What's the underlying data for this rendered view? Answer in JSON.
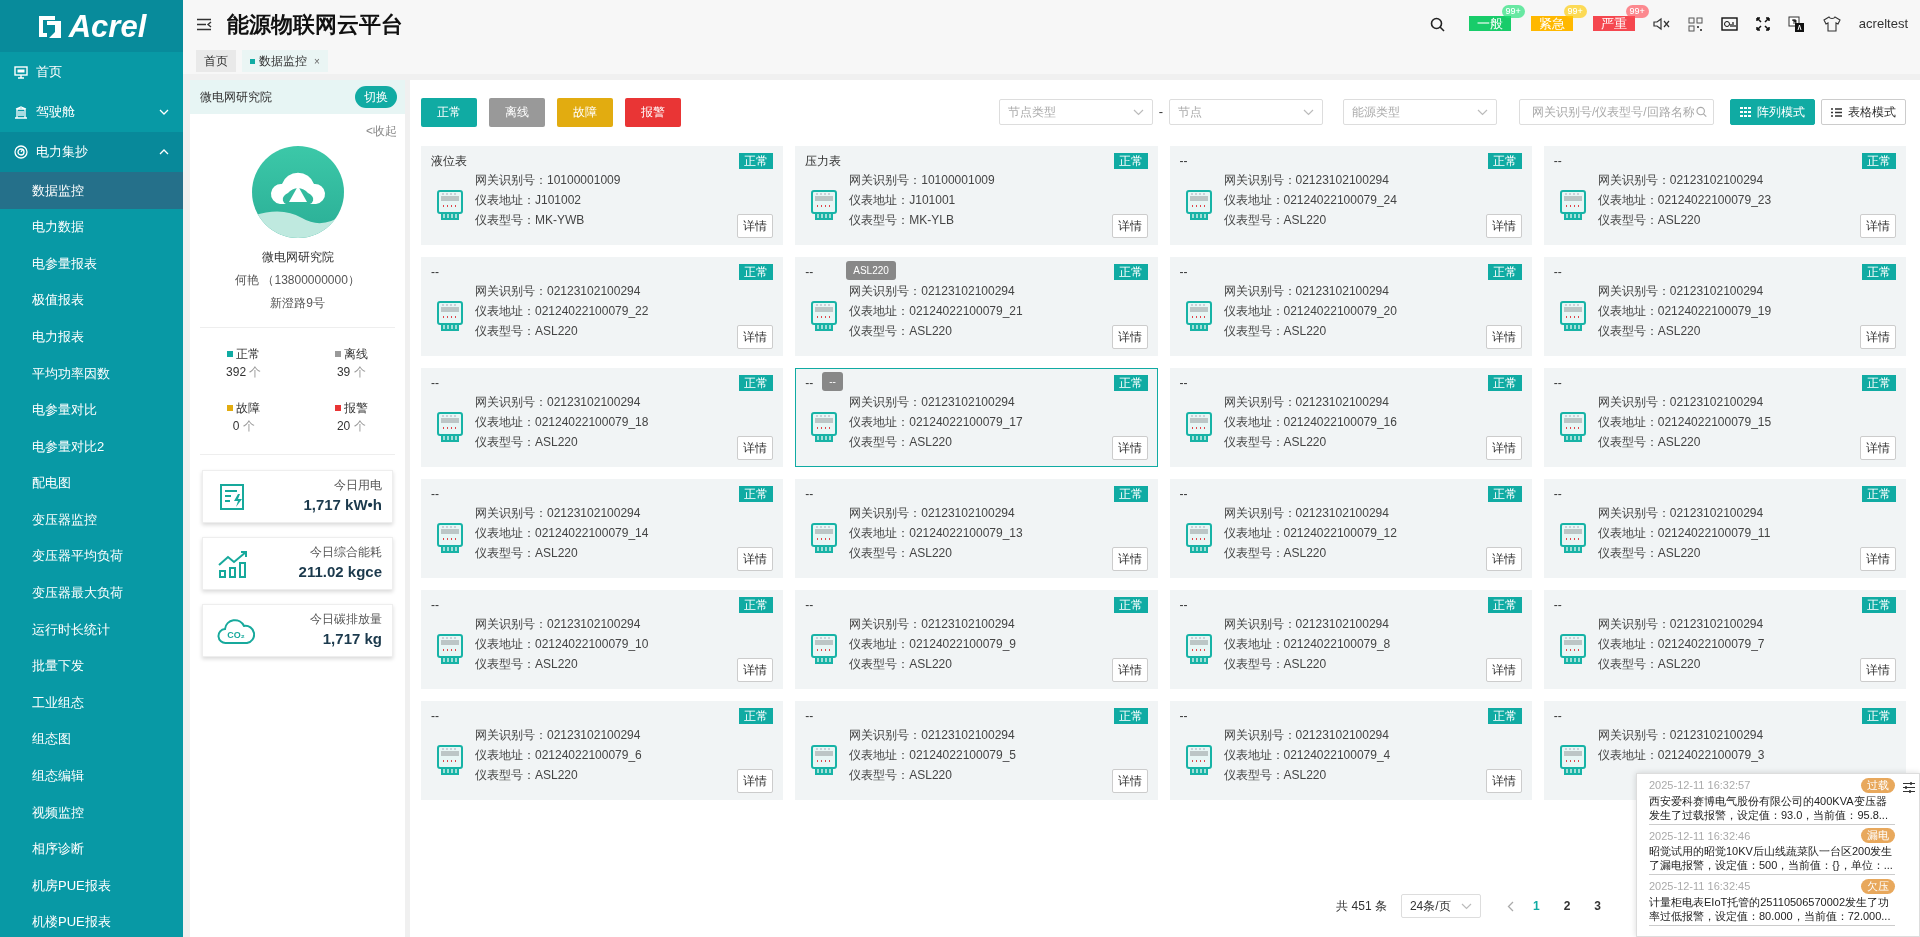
{
  "sidebar": {
    "logo": "Acrel",
    "items": [
      {
        "label": "首页",
        "selected": false
      },
      {
        "label": "驾驶舱",
        "selected": false,
        "expanded": false
      },
      {
        "label": "电力集抄",
        "selected": false,
        "expanded": true,
        "children": [
          {
            "label": "数据监控",
            "selected": true
          },
          {
            "label": "电力数据",
            "selected": false
          },
          {
            "label": "电参量报表",
            "selected": false
          },
          {
            "label": "极值报表",
            "selected": false
          },
          {
            "label": "电力报表",
            "selected": false
          },
          {
            "label": "平均功率因数",
            "selected": false
          },
          {
            "label": "电参量对比",
            "selected": false
          },
          {
            "label": "电参量对比2",
            "selected": false
          },
          {
            "label": "配电图",
            "selected": false
          },
          {
            "label": "变压器监控",
            "selected": false
          },
          {
            "label": "变压器平均负荷",
            "selected": false
          },
          {
            "label": "变压器最大负荷",
            "selected": false
          },
          {
            "label": "运行时长统计",
            "selected": false
          },
          {
            "label": "批量下发",
            "selected": false
          },
          {
            "label": "工业组态",
            "selected": false
          },
          {
            "label": "组态图",
            "selected": false
          },
          {
            "label": "组态编辑",
            "selected": false
          },
          {
            "label": "视频监控",
            "selected": false
          },
          {
            "label": "相序诊断",
            "selected": false
          },
          {
            "label": "机房PUE报表",
            "selected": false
          },
          {
            "label": "机楼PUE报表",
            "selected": false
          }
        ]
      }
    ]
  },
  "header": {
    "title": "能源物联网云平台",
    "alerts": [
      {
        "label": "一般",
        "count": "99+",
        "color": "#18cc6a"
      },
      {
        "label": "紧急",
        "count": "99+",
        "color": "#ffb800"
      },
      {
        "label": "严重",
        "count": "99+",
        "color": "#f5474f"
      }
    ],
    "user": "acreltest"
  },
  "tabs": [
    {
      "label": "首页",
      "selected": false
    },
    {
      "label": "数据监控",
      "selected": true,
      "close": "×"
    }
  ],
  "station": {
    "name": "微电网研究院",
    "switch_label": "切换",
    "collapse_label": "<收起",
    "title": "微电网研究院",
    "contact": "何艳 （13800000000）",
    "address": "新澄路9号",
    "status_counts": [
      {
        "label": "正常",
        "count": "392",
        "unit": "个",
        "color": "#10aba3"
      },
      {
        "label": "离线",
        "count": "39",
        "unit": "个",
        "color": "#999999"
      },
      {
        "label": "故障",
        "count": "0",
        "unit": "个",
        "color": "#e2ac10"
      },
      {
        "label": "报警",
        "count": "20",
        "unit": "个",
        "color": "#e93535"
      }
    ],
    "stats": [
      {
        "label": "今日用电",
        "value": "1,717 kW•h"
      },
      {
        "label": "今日综合能耗",
        "value": "211.02 kgce"
      },
      {
        "icon_text": "CO₂",
        "label": "今日碳排放量",
        "value": "1,717 kg"
      }
    ]
  },
  "status_filters": [
    {
      "label": "正常",
      "color": "#10aba3"
    },
    {
      "label": "离线",
      "color": "#999999"
    },
    {
      "label": "故障",
      "color": "#e2ac10"
    },
    {
      "label": "报警",
      "color": "#e93535"
    }
  ],
  "filters": {
    "selects": [
      {
        "placeholder": "节点类型"
      },
      {
        "placeholder": "节点"
      },
      {
        "placeholder": "能源类型"
      }
    ],
    "separator": "-",
    "search_placeholder": "网关识别号/仪表型号/回路名称",
    "view_modes": [
      {
        "label": "阵列模式",
        "selected": true
      },
      {
        "label": "表格模式",
        "selected": false
      }
    ]
  },
  "cards": [
    {
      "title": "液位表",
      "status": "正常",
      "gateway": "网关识别号：10100001009",
      "address": "仪表地址：J101002",
      "model": "仪表型号：MK-YWB",
      "detail": "详情",
      "selected": false
    },
    {
      "title": "压力表",
      "status": "正常",
      "gateway": "网关识别号：10100001009",
      "address": "仪表地址：J101001",
      "model": "仪表型号：MK-YLB",
      "detail": "详情",
      "selected": false
    },
    {
      "title": "--",
      "status": "正常",
      "gateway": "网关识别号：02123102100294",
      "address": "仪表地址：02124022100079_24",
      "model": "仪表型号：ASL220",
      "detail": "详情",
      "selected": false
    },
    {
      "title": "--",
      "status": "正常",
      "gateway": "网关识别号：02123102100294",
      "address": "仪表地址：02124022100079_23",
      "model": "仪表型号：ASL220",
      "detail": "详情",
      "selected": false
    },
    {
      "title": "--",
      "status": "正常",
      "gateway": "网关识别号：02123102100294",
      "address": "仪表地址：02124022100079_22",
      "model": "仪表型号：ASL220",
      "detail": "详情",
      "selected": false
    },
    {
      "title": "--",
      "status": "正常",
      "gateway": "网关识别号：02123102100294",
      "address": "仪表地址：02124022100079_21",
      "model": "仪表型号：ASL220",
      "detail": "详情",
      "selected": false,
      "tooltip": "ASL220"
    },
    {
      "title": "--",
      "status": "正常",
      "gateway": "网关识别号：02123102100294",
      "address": "仪表地址：02124022100079_20",
      "model": "仪表型号：ASL220",
      "detail": "详情",
      "selected": false
    },
    {
      "title": "--",
      "status": "正常",
      "gateway": "网关识别号：02123102100294",
      "address": "仪表地址：02124022100079_19",
      "model": "仪表型号：ASL220",
      "detail": "详情",
      "selected": false
    },
    {
      "title": "--",
      "status": "正常",
      "gateway": "网关识别号：02123102100294",
      "address": "仪表地址：02124022100079_18",
      "model": "仪表型号：ASL220",
      "detail": "详情",
      "selected": false
    },
    {
      "title": "--",
      "status": "正常",
      "gateway": "网关识别号：02123102100294",
      "address": "仪表地址：02124022100079_17",
      "model": "仪表型号：ASL220",
      "detail": "详情",
      "selected": true,
      "title_tooltip": "--"
    },
    {
      "title": "--",
      "status": "正常",
      "gateway": "网关识别号：02123102100294",
      "address": "仪表地址：02124022100079_16",
      "model": "仪表型号：ASL220",
      "detail": "详情",
      "selected": false
    },
    {
      "title": "--",
      "status": "正常",
      "gateway": "网关识别号：02123102100294",
      "address": "仪表地址：02124022100079_15",
      "model": "仪表型号：ASL220",
      "detail": "详情",
      "selected": false
    },
    {
      "title": "--",
      "status": "正常",
      "gateway": "网关识别号：02123102100294",
      "address": "仪表地址：02124022100079_14",
      "model": "仪表型号：ASL220",
      "detail": "详情",
      "selected": false
    },
    {
      "title": "--",
      "status": "正常",
      "gateway": "网关识别号：02123102100294",
      "address": "仪表地址：02124022100079_13",
      "model": "仪表型号：ASL220",
      "detail": "详情",
      "selected": false
    },
    {
      "title": "--",
      "status": "正常",
      "gateway": "网关识别号：02123102100294",
      "address": "仪表地址：02124022100079_12",
      "model": "仪表型号：ASL220",
      "detail": "详情",
      "selected": false
    },
    {
      "title": "--",
      "status": "正常",
      "gateway": "网关识别号：02123102100294",
      "address": "仪表地址：02124022100079_11",
      "model": "仪表型号：ASL220",
      "detail": "详情",
      "selected": false
    },
    {
      "title": "--",
      "status": "正常",
      "gateway": "网关识别号：02123102100294",
      "address": "仪表地址：02124022100079_10",
      "model": "仪表型号：ASL220",
      "detail": "详情",
      "selected": false
    },
    {
      "title": "--",
      "status": "正常",
      "gateway": "网关识别号：02123102100294",
      "address": "仪表地址：02124022100079_9",
      "model": "仪表型号：ASL220",
      "detail": "详情",
      "selected": false
    },
    {
      "title": "--",
      "status": "正常",
      "gateway": "网关识别号：02123102100294",
      "address": "仪表地址：02124022100079_8",
      "model": "仪表型号：ASL220",
      "detail": "详情",
      "selected": false
    },
    {
      "title": "--",
      "status": "正常",
      "gateway": "网关识别号：02123102100294",
      "address": "仪表地址：02124022100079_7",
      "model": "仪表型号：ASL220",
      "detail": "详情",
      "selected": false
    },
    {
      "title": "--",
      "status": "正常",
      "gateway": "网关识别号：02123102100294",
      "address": "仪表地址：02124022100079_6",
      "model": "仪表型号：ASL220",
      "detail": "详情",
      "selected": false
    },
    {
      "title": "--",
      "status": "正常",
      "gateway": "网关识别号：02123102100294",
      "address": "仪表地址：02124022100079_5",
      "model": "仪表型号：ASL220",
      "detail": "详情",
      "selected": false
    },
    {
      "title": "--",
      "status": "正常",
      "gateway": "网关识别号：02123102100294",
      "address": "仪表地址：02124022100079_4",
      "model": "仪表型号：ASL220",
      "detail": "详情",
      "selected": false
    },
    {
      "title": "--",
      "status": "正常",
      "gateway": "网关识别号：02123102100294",
      "address": "仪表地址：02124022100079_3",
      "selected": false
    }
  ],
  "pagination": {
    "total": "共 451 条",
    "page_size": "24条/页",
    "pages": [
      {
        "label": "1",
        "selected": true
      },
      {
        "label": "2",
        "selected": false
      },
      {
        "label": "3",
        "selected": false
      }
    ]
  },
  "notifications": [
    {
      "time": "2025-12-11 16:32:57",
      "tag": "过载",
      "text": "西安爱科赛博电气股份有限公司的400KVA变压器发生了过载报警，设定值：93.0，当前值：95.8..."
    },
    {
      "time": "2025-12-11 16:32:46",
      "tag": "漏电",
      "text": "昭觉试用的昭觉10KV后山线蔬菜队一台区200发生了漏电报警，设定值：500，当前值：{}，单位：..."
    },
    {
      "time": "2025-12-11 16:32:45",
      "tag": "欠压",
      "text": "计量柜电表EIoT托管的25110506570002发生了功率过低报警，设定值：80.000，当前值：72.000..."
    }
  ]
}
